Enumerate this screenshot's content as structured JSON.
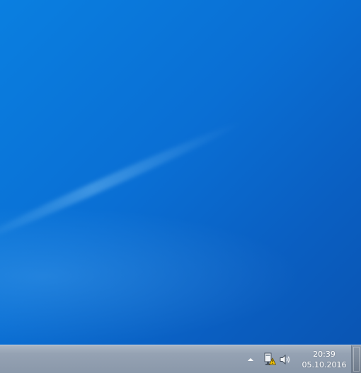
{
  "taskbar": {
    "tray": {
      "show_hidden_icons": "show-hidden-icons-arrow",
      "icons": [
        "action-center-warning-icon",
        "volume-icon"
      ]
    },
    "clock": {
      "time": "20:39",
      "date": "05.10.2016"
    }
  },
  "colors": {
    "desktop_blue": "#0a6fd4",
    "taskbar_gray": "#95a2b3",
    "clock_text": "#ffffff",
    "warning_badge": "#f2c200"
  }
}
